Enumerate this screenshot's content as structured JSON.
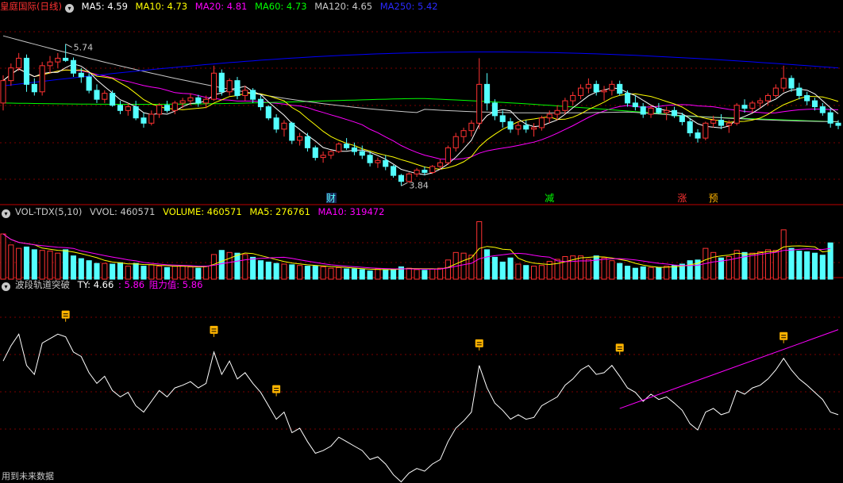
{
  "colors": {
    "up": "#ff3232",
    "down": "#54ffff",
    "ma5": "#ffffff",
    "ma10": "#ffff00",
    "ma20": "#ff00ff",
    "ma60": "#00ff00",
    "ma120": "#c8c8c8",
    "ma250": "#0000ff",
    "grid": "#7a0000",
    "panel_sep": "#c00000",
    "marker": "#ffb400"
  },
  "panel1": {
    "title": "皇庭国际(日线)",
    "ma5": "MA5: 4.59",
    "ma10": "MA10: 4.73",
    "ma20": "MA20: 4.81",
    "ma60": "MA60: 4.73",
    "ma120": "MA120: 4.65",
    "ma250": "MA250: 5.42",
    "high_label": "5.74",
    "low_label": "3.84",
    "tags": [
      {
        "text": "财",
        "color": "#54ffff"
      },
      {
        "text": "减",
        "color": "#00ff00"
      },
      {
        "text": "涨",
        "color": "#ff3232"
      },
      {
        "text": "预",
        "color": "#ffb400"
      }
    ]
  },
  "panel2": {
    "title": "VOL-TDX(5,10)",
    "vvol": "VVOL: 460571",
    "volume": "VOLUME: 460571",
    "ma5": "MA5: 276761",
    "ma10": "MA10: 319472"
  },
  "panel3": {
    "title": "波段轨道突破",
    "ty": "TY: 4.66",
    "val2": ": 5.86",
    "resist": "阻力值: 5.86",
    "marker_icon": "box-icon"
  },
  "footer": "用到未来数据",
  "chart_data": [
    {
      "type": "candlestick",
      "ohlc": [
        [
          4.95,
          5.32,
          4.85,
          5.25
        ],
        [
          5.25,
          5.48,
          5.18,
          5.42
        ],
        [
          5.42,
          5.62,
          5.38,
          5.55
        ],
        [
          5.55,
          5.6,
          5.1,
          5.2
        ],
        [
          5.2,
          5.28,
          5.05,
          5.1
        ],
        [
          5.1,
          5.5,
          5.05,
          5.45
        ],
        [
          5.45,
          5.58,
          5.35,
          5.5
        ],
        [
          5.5,
          5.62,
          5.42,
          5.55
        ],
        [
          5.55,
          5.74,
          5.5,
          5.52
        ],
        [
          5.52,
          5.56,
          5.3,
          5.35
        ],
        [
          5.35,
          5.42,
          5.22,
          5.3
        ],
        [
          5.3,
          5.35,
          5.08,
          5.12
        ],
        [
          5.12,
          5.2,
          4.95,
          5.0
        ],
        [
          5.0,
          5.12,
          4.95,
          5.08
        ],
        [
          5.08,
          5.12,
          4.9,
          4.92
        ],
        [
          4.92,
          4.98,
          4.8,
          4.85
        ],
        [
          4.85,
          4.95,
          4.78,
          4.9
        ],
        [
          4.9,
          4.98,
          4.72,
          4.75
        ],
        [
          4.75,
          4.82,
          4.62,
          4.68
        ],
        [
          4.68,
          4.85,
          4.65,
          4.8
        ],
        [
          4.8,
          4.95,
          4.75,
          4.92
        ],
        [
          4.92,
          4.98,
          4.82,
          4.85
        ],
        [
          4.85,
          4.98,
          4.8,
          4.95
        ],
        [
          4.95,
          5.02,
          4.88,
          4.98
        ],
        [
          4.98,
          5.08,
          4.92,
          5.02
        ],
        [
          5.02,
          5.06,
          4.9,
          4.95
        ],
        [
          4.95,
          5.05,
          4.88,
          5.0
        ],
        [
          5.0,
          5.45,
          4.98,
          5.35
        ],
        [
          5.35,
          5.4,
          5.05,
          5.1
        ],
        [
          5.1,
          5.28,
          5.05,
          5.25
        ],
        [
          5.25,
          5.3,
          5.0,
          5.05
        ],
        [
          5.05,
          5.18,
          4.98,
          5.12
        ],
        [
          5.12,
          5.15,
          4.95,
          5.0
        ],
        [
          5.0,
          5.05,
          4.85,
          4.9
        ],
        [
          4.9,
          4.92,
          4.72,
          4.75
        ],
        [
          4.75,
          4.8,
          4.55,
          4.6
        ],
        [
          4.6,
          4.72,
          4.5,
          4.68
        ],
        [
          4.68,
          4.7,
          4.4,
          4.45
        ],
        [
          4.45,
          4.55,
          4.38,
          4.5
        ],
        [
          4.5,
          4.55,
          4.3,
          4.35
        ],
        [
          4.35,
          4.38,
          4.18,
          4.22
        ],
        [
          4.22,
          4.3,
          4.15,
          4.25
        ],
        [
          4.25,
          4.32,
          4.2,
          4.3
        ],
        [
          4.3,
          4.42,
          4.28,
          4.4
        ],
        [
          4.4,
          4.48,
          4.32,
          4.35
        ],
        [
          4.35,
          4.42,
          4.25,
          4.3
        ],
        [
          4.3,
          4.38,
          4.2,
          4.25
        ],
        [
          4.25,
          4.3,
          4.1,
          4.15
        ],
        [
          4.15,
          4.22,
          4.08,
          4.18
        ],
        [
          4.18,
          4.25,
          4.05,
          4.1
        ],
        [
          4.1,
          4.12,
          3.95,
          3.98
        ],
        [
          3.98,
          4.0,
          3.84,
          3.9
        ],
        [
          3.9,
          4.02,
          3.88,
          4.0
        ],
        [
          4.0,
          4.08,
          3.96,
          4.05
        ],
        [
          4.05,
          4.1,
          3.98,
          4.02
        ],
        [
          4.02,
          4.12,
          4.0,
          4.1
        ],
        [
          4.1,
          4.2,
          4.06,
          4.15
        ],
        [
          4.15,
          4.38,
          4.12,
          4.35
        ],
        [
          4.35,
          4.55,
          4.3,
          4.5
        ],
        [
          4.5,
          4.62,
          4.42,
          4.58
        ],
        [
          4.58,
          4.72,
          4.5,
          4.68
        ],
        [
          4.68,
          5.55,
          4.6,
          5.2
        ],
        [
          5.2,
          5.35,
          4.85,
          4.95
        ],
        [
          4.95,
          5.0,
          4.72,
          4.78
        ],
        [
          4.78,
          4.85,
          4.62,
          4.7
        ],
        [
          4.7,
          4.75,
          4.55,
          4.6
        ],
        [
          4.6,
          4.7,
          4.52,
          4.65
        ],
        [
          4.65,
          4.72,
          4.55,
          4.6
        ],
        [
          4.6,
          4.68,
          4.5,
          4.62
        ],
        [
          4.62,
          4.78,
          4.58,
          4.75
        ],
        [
          4.75,
          4.85,
          4.68,
          4.8
        ],
        [
          4.8,
          4.92,
          4.72,
          4.85
        ],
        [
          4.85,
          5.02,
          4.8,
          4.98
        ],
        [
          4.98,
          5.1,
          4.92,
          5.05
        ],
        [
          5.05,
          5.2,
          5.0,
          5.15
        ],
        [
          5.15,
          5.28,
          5.08,
          5.2
        ],
        [
          5.2,
          5.25,
          5.05,
          5.1
        ],
        [
          5.1,
          5.18,
          4.98,
          5.12
        ],
        [
          5.12,
          5.25,
          5.05,
          5.2
        ],
        [
          5.2,
          5.25,
          5.05,
          5.08
        ],
        [
          5.08,
          5.12,
          4.9,
          4.95
        ],
        [
          4.95,
          5.05,
          4.85,
          4.9
        ],
        [
          4.9,
          4.95,
          4.75,
          4.8
        ],
        [
          4.8,
          4.92,
          4.75,
          4.88
        ],
        [
          4.88,
          4.95,
          4.8,
          4.82
        ],
        [
          4.82,
          4.9,
          4.72,
          4.85
        ],
        [
          4.85,
          4.9,
          4.75,
          4.78
        ],
        [
          4.78,
          4.82,
          4.65,
          4.7
        ],
        [
          4.7,
          4.75,
          4.5,
          4.55
        ],
        [
          4.55,
          4.6,
          4.42,
          4.48
        ],
        [
          4.48,
          4.7,
          4.45,
          4.68
        ],
        [
          4.68,
          4.78,
          4.62,
          4.72
        ],
        [
          4.72,
          4.8,
          4.6,
          4.65
        ],
        [
          4.65,
          4.72,
          4.55,
          4.68
        ],
        [
          4.68,
          4.95,
          4.65,
          4.92
        ],
        [
          4.92,
          5.0,
          4.82,
          4.88
        ],
        [
          4.88,
          4.98,
          4.82,
          4.95
        ],
        [
          4.95,
          5.02,
          4.88,
          4.98
        ],
        [
          4.98,
          5.08,
          4.92,
          5.05
        ],
        [
          5.05,
          5.2,
          5.02,
          5.15
        ],
        [
          5.15,
          5.45,
          5.1,
          5.28
        ],
        [
          5.28,
          5.32,
          5.1,
          5.15
        ],
        [
          5.15,
          5.22,
          5.0,
          5.05
        ],
        [
          5.05,
          5.1,
          4.92,
          4.98
        ],
        [
          4.98,
          5.02,
          4.85,
          4.9
        ],
        [
          4.9,
          4.95,
          4.78,
          4.82
        ],
        [
          4.82,
          4.88,
          4.62,
          4.68
        ],
        [
          4.68,
          4.72,
          4.6,
          4.65
        ]
      ],
      "ma_values": {
        "MA5": 4.59,
        "MA10": 4.73,
        "MA20": 4.81,
        "MA60": 4.73,
        "MA120": 4.65,
        "MA250": 5.42
      },
      "high": 5.74,
      "low": 3.84
    },
    {
      "type": "bar",
      "series_name": "VOLUME",
      "values": [
        330000,
        250000,
        225000,
        235000,
        215000,
        210000,
        205000,
        190000,
        215000,
        170000,
        150000,
        135000,
        115000,
        115000,
        110000,
        120000,
        95000,
        115000,
        95000,
        105000,
        95000,
        85000,
        95000,
        95000,
        90000,
        80000,
        95000,
        180000,
        210000,
        195000,
        190000,
        180000,
        160000,
        135000,
        125000,
        115000,
        110000,
        105000,
        100000,
        95000,
        95000,
        90000,
        80000,
        85000,
        75000,
        75000,
        70000,
        60000,
        75000,
        70000,
        75000,
        90000,
        80000,
        70000,
        65000,
        75000,
        80000,
        140000,
        195000,
        190000,
        175000,
        420000,
        215000,
        160000,
        125000,
        155000,
        110000,
        100000,
        95000,
        100000,
        130000,
        145000,
        165000,
        170000,
        170000,
        145000,
        170000,
        155000,
        135000,
        115000,
        95000,
        80000,
        90000,
        85000,
        85000,
        95000,
        100000,
        110000,
        135000,
        140000,
        225000,
        195000,
        155000,
        165000,
        210000,
        195000,
        190000,
        200000,
        215000,
        210000,
        360000,
        225000,
        205000,
        200000,
        190000,
        175000,
        265000
      ],
      "ma_values": {
        "MA5": 276761,
        "MA10": 319472
      }
    },
    {
      "type": "line",
      "values": [
        4.66
      ],
      "resistance": 5.86
    }
  ]
}
